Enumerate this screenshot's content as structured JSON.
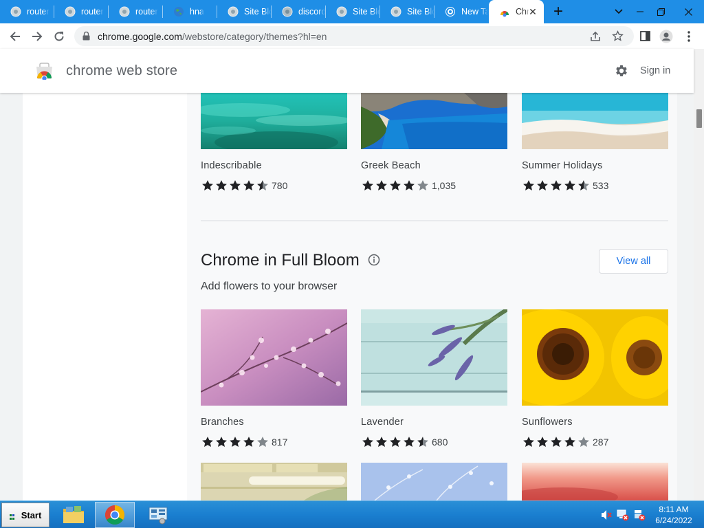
{
  "browser": {
    "tabs": [
      {
        "title": "router",
        "icon": "globe-icon"
      },
      {
        "title": "router",
        "icon": "globe-icon"
      },
      {
        "title": "router",
        "icon": "globe-icon"
      },
      {
        "title": "hna",
        "icon": "earth-icon"
      },
      {
        "title": "Site Blo",
        "icon": "globe-icon"
      },
      {
        "title": "discord",
        "icon": "globe-icon"
      },
      {
        "title": "Site Blo",
        "icon": "globe-icon"
      },
      {
        "title": "Site Blo",
        "icon": "globe-icon"
      },
      {
        "title": "New Ta",
        "icon": "chrome-icon"
      }
    ],
    "active_tab": {
      "title": "Chr",
      "icon": "webstore-icon"
    },
    "url_host": "chrome.google.com",
    "url_path": "/webstore/category/themes?hl=en",
    "accent": "#1f8ee6"
  },
  "store": {
    "title": "chrome web store",
    "sign_in": "Sign in"
  },
  "top_row": [
    {
      "title": "Indescribable",
      "rating": 4.5,
      "count": "780",
      "image": "turquoise-water"
    },
    {
      "title": "Greek Beach",
      "rating": 4,
      "count": "1,035",
      "image": "navagio-beach"
    },
    {
      "title": "Summer Holidays",
      "rating": 4.5,
      "count": "533",
      "image": "beach-waves"
    }
  ],
  "section": {
    "title": "Chrome in Full Bloom",
    "subtitle": "Add flowers to your browser",
    "view_all": "View all",
    "items": [
      {
        "title": "Branches",
        "rating": 4,
        "count": "817",
        "image": "pink-blossom"
      },
      {
        "title": "Lavender",
        "rating": 4.5,
        "count": "680",
        "image": "lavender-on-wood"
      },
      {
        "title": "Sunflowers",
        "rating": 4,
        "count": "287",
        "image": "sunflowers"
      }
    ]
  },
  "taskbar": {
    "start_label": "Start",
    "time": "8:11 AM",
    "date": "6/24/2022"
  }
}
